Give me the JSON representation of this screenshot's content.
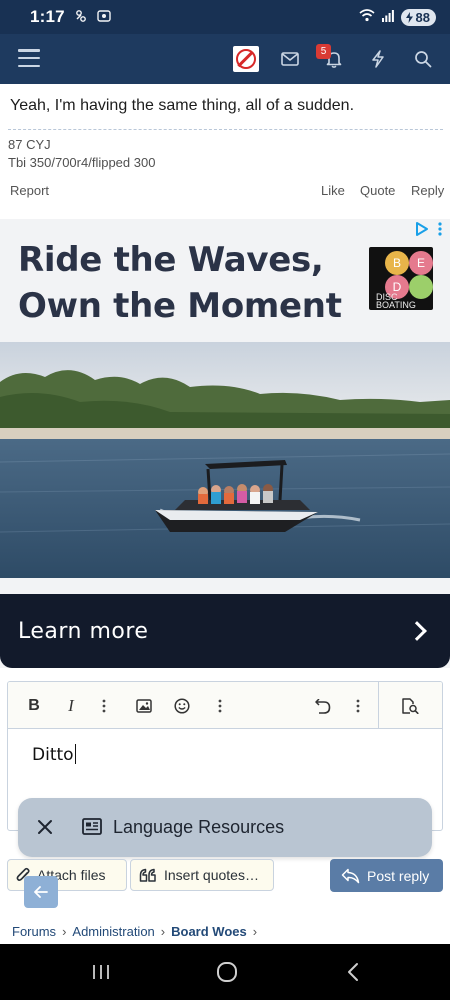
{
  "status_bar": {
    "time": "1:17",
    "battery": "88",
    "icons": [
      "cloud-sync-icon",
      "screen-record-icon",
      "wifi-icon",
      "signal-icon",
      "battery-icon"
    ]
  },
  "header": {
    "icons": [
      "menu-icon",
      "avatar",
      "mail-icon",
      "bell-icon",
      "lightning-icon",
      "search-icon"
    ],
    "notification_count": "5"
  },
  "post": {
    "text": "Yeah, I'm having the same thing, all of a sudden.",
    "signature": [
      "87 CYJ",
      "Tbi 350/700r4/flipped 300"
    ],
    "actions": {
      "report": "Report",
      "like": "Like",
      "quote": "Quote",
      "reply": "Reply"
    }
  },
  "ad": {
    "headline_line1": "Ride the Waves,",
    "headline_line2": "Own the Moment",
    "logo_letters": [
      "B",
      "E",
      "D"
    ],
    "logo_text_1": "DISC",
    "logo_text_2": "BOATING",
    "cta": "Learn more",
    "colors": {
      "cta_background": "#121a2b",
      "headline": "#2b3347"
    }
  },
  "editor": {
    "toolbar": [
      "bold-icon",
      "italic-icon",
      "more-icon",
      "image-icon",
      "emoji-icon",
      "more-icon",
      "undo-icon",
      "more-icon",
      "preview-icon"
    ],
    "bold_label": "B",
    "italic_label": "I",
    "value": "Ditto"
  },
  "snackbar": {
    "label": "Language Resources",
    "icons": [
      "close-icon",
      "news-icon"
    ]
  },
  "buttons": {
    "attach": "Attach files",
    "insert_quotes": "Insert quotes…",
    "post_reply": "Post reply"
  },
  "breadcrumb": {
    "items": [
      "Forums",
      "Administration",
      "Board Woes"
    ]
  },
  "nav_bar": {
    "icons": [
      "recents-icon",
      "home-icon",
      "back-icon"
    ]
  },
  "colors": {
    "header": "#1e3a5f",
    "status_bar": "#183153",
    "accent": "#5a7ca6",
    "link": "#234a78",
    "badge": "#d93a34"
  }
}
